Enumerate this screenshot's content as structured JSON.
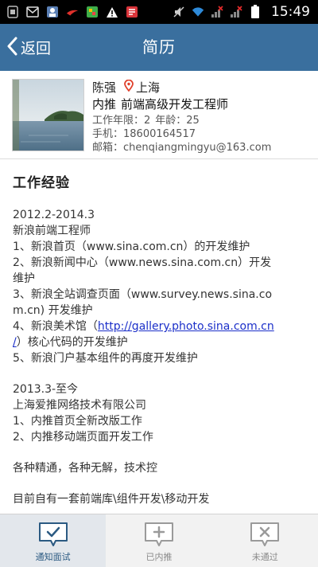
{
  "status_bar": {
    "time": "15:49",
    "icons": [
      "sim-card-icon",
      "mail-icon",
      "image-icon",
      "bird-icon",
      "app-icon",
      "warning-icon",
      "news-icon",
      "mute-icon",
      "wifi-icon",
      "signal-icon",
      "signal-icon",
      "battery-icon"
    ]
  },
  "header": {
    "back_label": "返回",
    "title": "简历",
    "bg_color": "#3a6f9e"
  },
  "profile": {
    "name": "陈强",
    "location": "上海",
    "job_prefix": "内推",
    "job_title": "前端高级开发工程师",
    "years_label": "工作年限：2",
    "age_label": "年龄：25",
    "phone_label": "手机：18600164517",
    "email_label": "邮箱：chenqiangmingyu@163.com"
  },
  "experience": {
    "title": "工作经验",
    "job1": {
      "period": "2012.2-2014.3",
      "role": "新浪前端工程师",
      "item1": "1、新浪首页（www.sina.com.cn）的开发维护",
      "item2a": "2、新浪新闻中心（www.news.sina.com.cn）开发",
      "item2b": "维护",
      "item3a": "3、新浪全站调查页面（www.survey.news.sina.co",
      "item3b": "m.cn) 开发维护",
      "item4_prefix": "4、新浪美术馆（",
      "item4_link_a": "http://gallery.photo.sina.com.cn",
      "item4_link_b": "/",
      "item4_suffix": "）核心代码的开发维护",
      "item5": "5、新浪门户基本组件的再度开发维护"
    },
    "job2": {
      "period": "2013.3-至今",
      "company": "上海爱推网络技术有限公司",
      "item1": "1、内推首页全新改版工作",
      "item2": "2、内推移动端页面开发工作"
    },
    "note1": "各种精通，各种无解，技术控",
    "note2": "目前自有一套前端库\\组件开发\\移动开发"
  },
  "tabs": [
    {
      "label": "通知面试",
      "icon": "chat-check-icon"
    },
    {
      "label": "已内推",
      "icon": "chat-plus-icon"
    },
    {
      "label": "未通过",
      "icon": "chat-x-icon"
    }
  ]
}
